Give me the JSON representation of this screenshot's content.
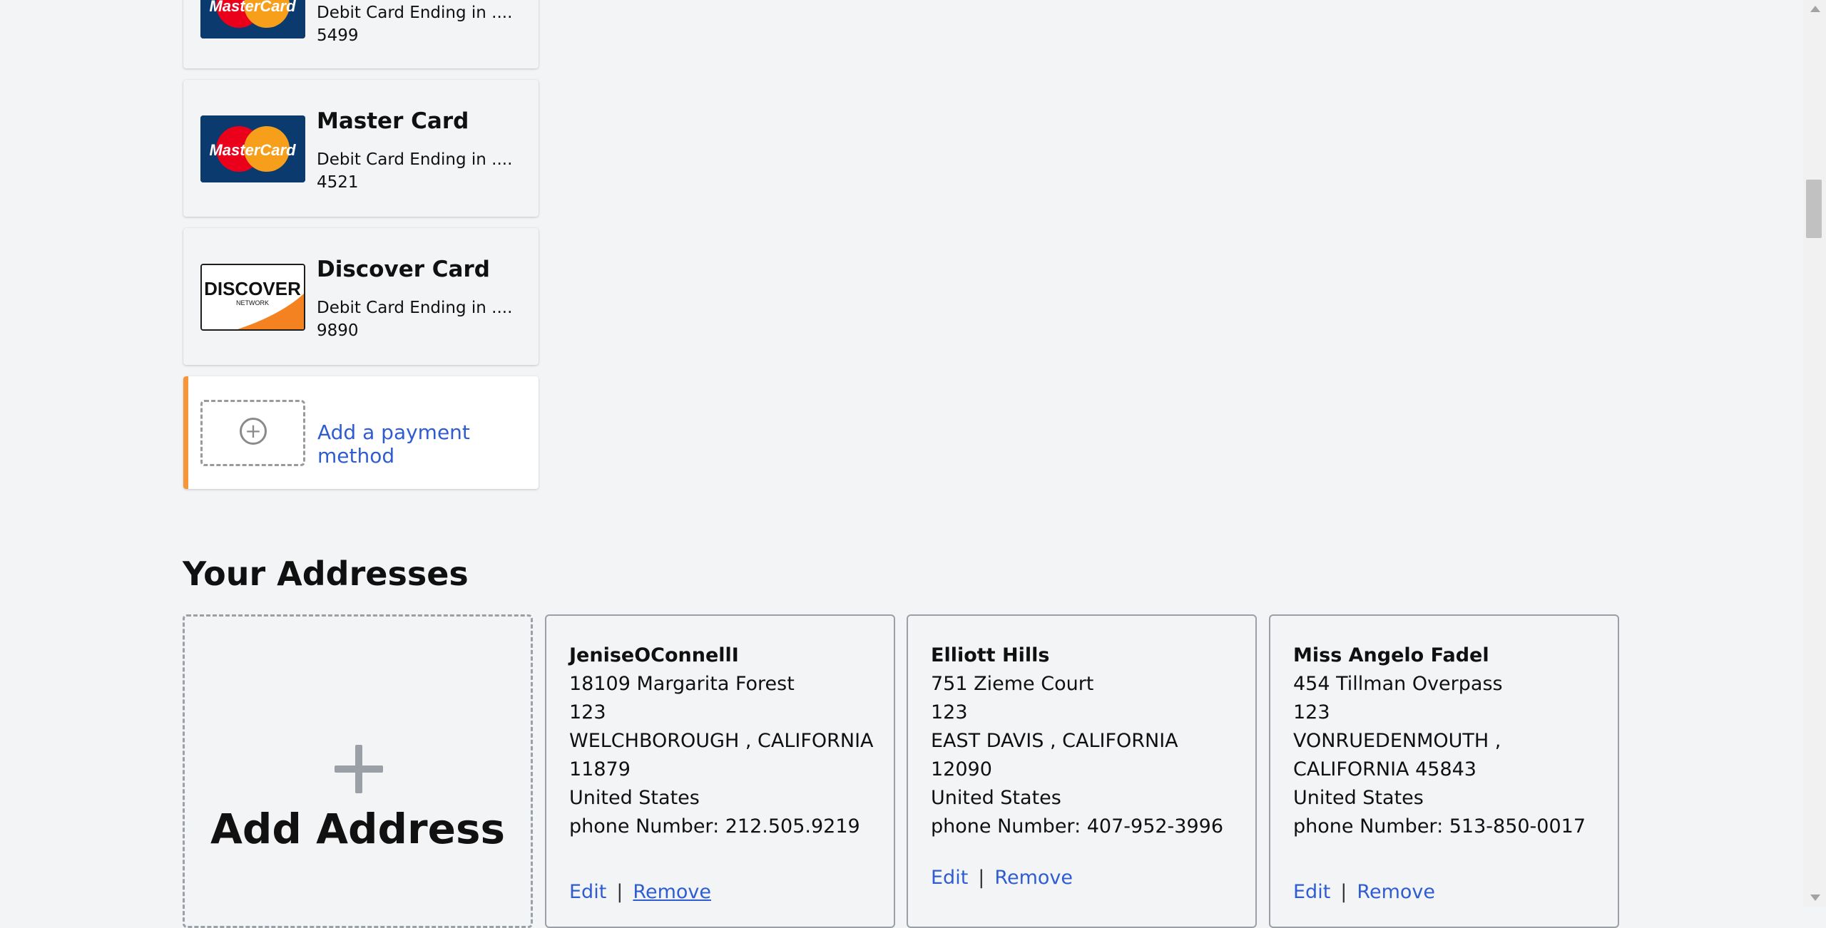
{
  "payment_cards": [
    {
      "title": "",
      "desc": "Debit Card Ending in .... 5499",
      "logo": "mastercard-logo"
    },
    {
      "title": "Master Card",
      "desc": "Debit Card Ending in .... 4521",
      "logo": "mastercard-logo"
    },
    {
      "title": "Discover Card",
      "desc": "Debit Card Ending in .... 9890",
      "logo": "discover-logo"
    }
  ],
  "logos": {
    "mastercard_text": "MasterCard",
    "discover_text": "DISCOVER",
    "discover_sub": "NETWORK"
  },
  "add_payment": {
    "label": "Add a payment method",
    "icon": "plus-circle-icon"
  },
  "addresses_title": "Your Addresses",
  "add_address": {
    "label": "Add Address",
    "icon": "plus-icon"
  },
  "addresses": [
    {
      "name": "JeniseOConnellI",
      "lines": [
        "18109 Margarita Forest",
        "123",
        "WELCHBOROUGH , CALIFORNIA",
        "11879",
        "United States",
        "phone Number: 212.505.9219"
      ],
      "edit": "Edit",
      "remove": "Remove"
    },
    {
      "name": "Elliott Hills",
      "lines": [
        "751 Zieme Court",
        "123",
        "EAST DAVIS , CALIFORNIA 12090",
        "United States",
        "phone Number: 407-952-3996"
      ],
      "edit": "Edit",
      "remove": "Remove"
    },
    {
      "name": "Miss Angelo Fadel",
      "lines": [
        "454 Tillman Overpass",
        "123",
        "VONRUEDENMOUTH ,",
        "CALIFORNIA 45843",
        "United States",
        "phone Number: 513-850-0017"
      ],
      "edit": "Edit",
      "remove": "Remove"
    }
  ],
  "separator": "|",
  "colors": {
    "link": "#2f5cd0",
    "accent_orange": "#f5963b",
    "mastercard_red": "#eb001b",
    "mastercard_yellow": "#f79e1b"
  }
}
